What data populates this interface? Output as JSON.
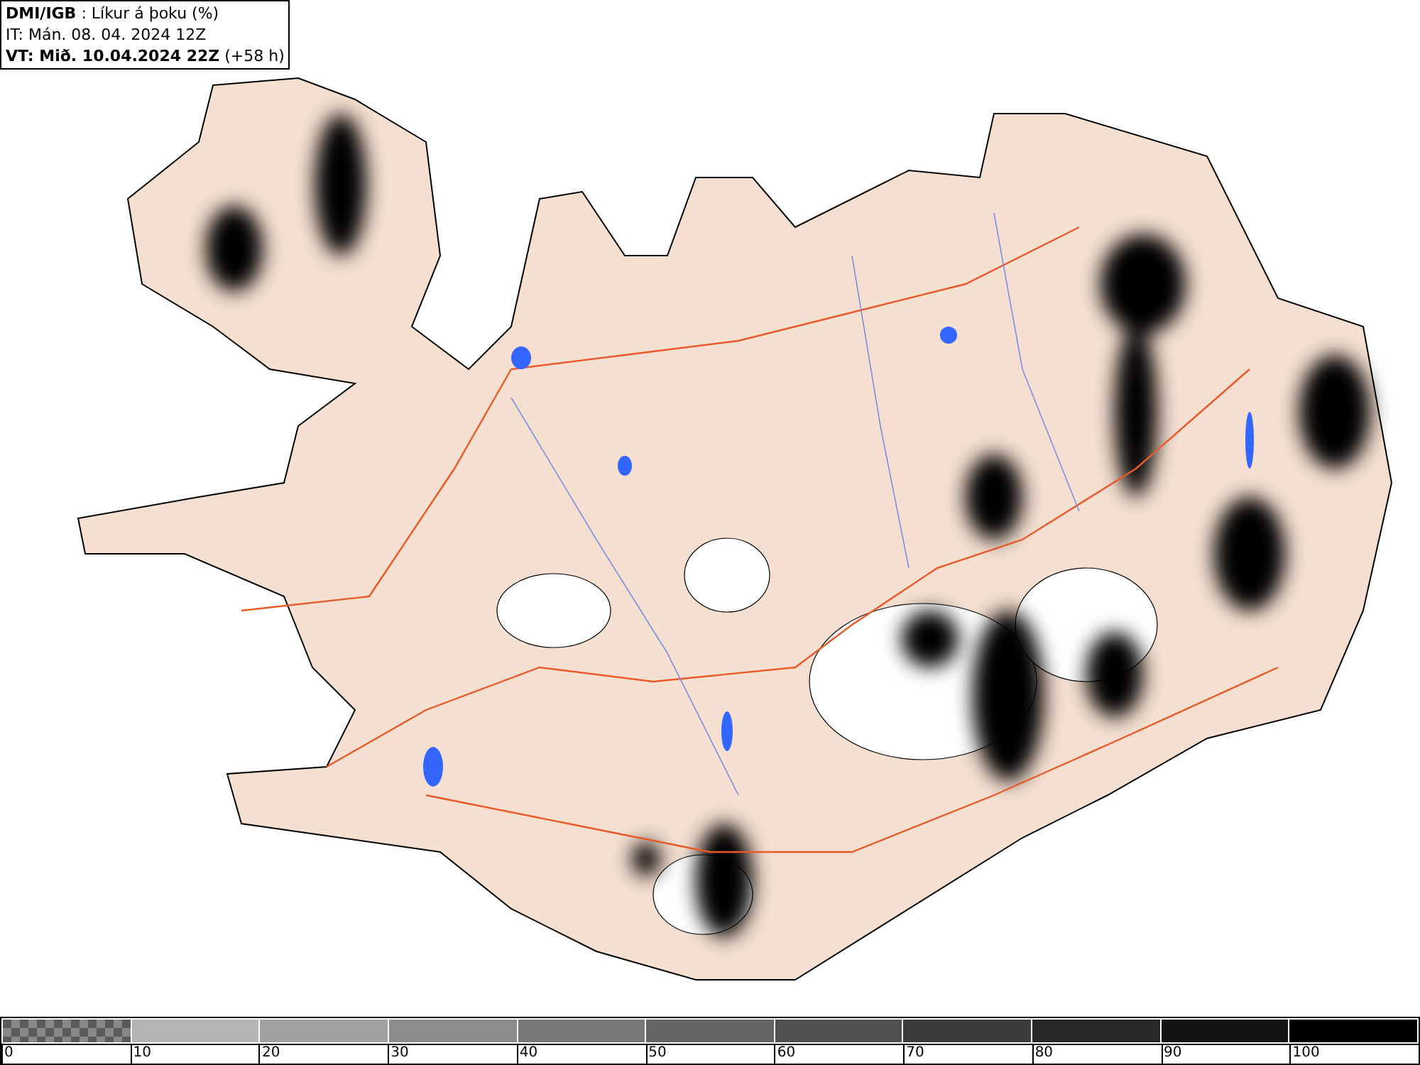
{
  "header": {
    "title": "**DMI/IGB** : Líkur á þoku (%)",
    "issue_time": "IT: Mán. 08. 04. 2024 12Z",
    "valid_time": "**VT: Mið. 10.04.2024 22Z** (+58 h)"
  },
  "legend": {
    "bins": [
      {
        "kind": "checker",
        "color": "#808080"
      },
      {
        "kind": "solid",
        "color": "#b4b4b4"
      },
      {
        "kind": "solid",
        "color": "#a0a0a0"
      },
      {
        "kind": "solid",
        "color": "#8c8c8c"
      },
      {
        "kind": "solid",
        "color": "#787878"
      },
      {
        "kind": "solid",
        "color": "#646464"
      },
      {
        "kind": "solid",
        "color": "#505050"
      },
      {
        "kind": "solid",
        "color": "#3c3c3c"
      },
      {
        "kind": "solid",
        "color": "#282828"
      },
      {
        "kind": "solid",
        "color": "#141414"
      },
      {
        "kind": "solid",
        "color": "#000000"
      }
    ],
    "labels": [
      "0",
      "10",
      "20",
      "30",
      "40",
      "50",
      "60",
      "70",
      "80",
      "90",
      "100"
    ]
  }
}
